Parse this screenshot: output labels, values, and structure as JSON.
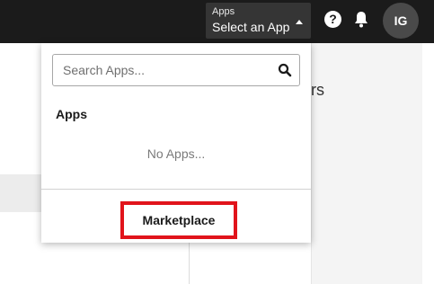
{
  "topbar": {
    "app_switcher": {
      "eyebrow": "Apps",
      "current": "Select an App"
    },
    "help_icon": "question-mark",
    "notifications_icon": "bell",
    "avatar_initials": "IG"
  },
  "background": {
    "heading_fragment": "rs"
  },
  "dropdown": {
    "search_placeholder": "Search Apps...",
    "section_title": "Apps",
    "empty_message": "No Apps...",
    "marketplace_label": "Marketplace",
    "highlight_color": "#e1141b"
  },
  "colors": {
    "topbar": "#1b1b1b",
    "switcher_bg": "#353535"
  }
}
